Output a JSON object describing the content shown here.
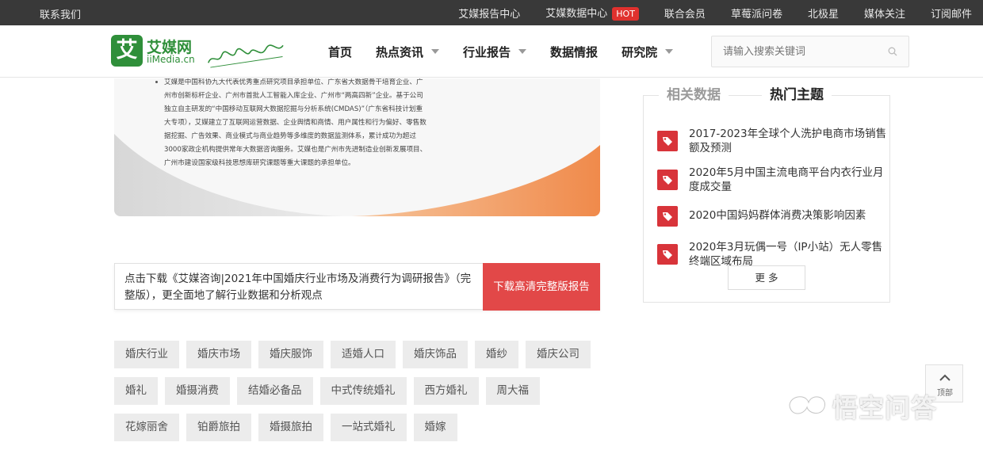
{
  "topbar": {
    "contact": "联系我们",
    "links": [
      "艾媒报告中心",
      "艾媒数据中心",
      "联合会员",
      "草莓派问卷",
      "北极星",
      "媒体关注",
      "订阅邮件"
    ],
    "hot_badge": "HOT"
  },
  "logo": {
    "cn": "艾媒网",
    "en": "iiMedia.cn",
    "mark": "艾"
  },
  "nav": {
    "items": [
      "首页",
      "热点资讯",
      "行业报告",
      "数据情报",
      "研究院"
    ]
  },
  "search": {
    "placeholder": "请输入搜索关键词"
  },
  "promo": {
    "intro": "艾媒是中国科协九大代表优秀重点研究项目承担单位、广东省大数据骨干培育企业、广州市创新标杆企业、广州市首批人工智能入库企业、广州市“两高四新”企业。基于公司独立自主研发的“中国移动互联网大数据挖掘与分析系统(CMDAS)”（广东省科技计划重大专项），艾媒建立了互联网运营数据、企业舆情和商情、用户属性和行为偏好、零售数据挖掘、广告效果、商业模式与商业趋势等多维度的数据监测体系，累计成功为超过3000家政企机构提供常年大数据咨询服务。艾媒也是广州市先进制造业创新发展项目、广州市建设国家级科技思想库研究课题等重大课题的承担单位。",
    "accent_color": "#f08a4b"
  },
  "download": {
    "text": "点击下载《艾媒咨询|2021年中国婚庆行业市场及消费行为调研报告》（完整版），更全面地了解行业数据和分析观点",
    "button": "下载高清完整版报告",
    "button_color": "#e24848"
  },
  "tags": [
    [
      "婚庆行业",
      "婚庆市场",
      "婚庆服饰",
      "适婚人口",
      "婚庆饰品",
      "婚纱",
      "婚庆公司"
    ],
    [
      "婚礼",
      "婚摄消费",
      "结婚必备品",
      "中式传统婚礼",
      "西方婚礼",
      "周大福"
    ],
    [
      "花嫁丽舍",
      "铂爵旅拍",
      "婚摄旅拍",
      "一站式婚礼",
      "婚嫁"
    ]
  ],
  "sidebar": {
    "tabs": [
      "相关数据",
      "热门主题"
    ],
    "items": [
      "2017-2023年全球个人洗护电商市场销售额及预测",
      "2020年5月中国主流电商平台内衣行业月度成交量",
      "2020中国妈妈群体消费决策影响因素",
      "2020年3月玩偶一号（IP小站）无人零售终端区域布局"
    ],
    "more": "更 多",
    "icon_color": "#d8343a"
  },
  "backtop": {
    "label": "顶部"
  },
  "watermark": {
    "text": "悟空问答"
  }
}
